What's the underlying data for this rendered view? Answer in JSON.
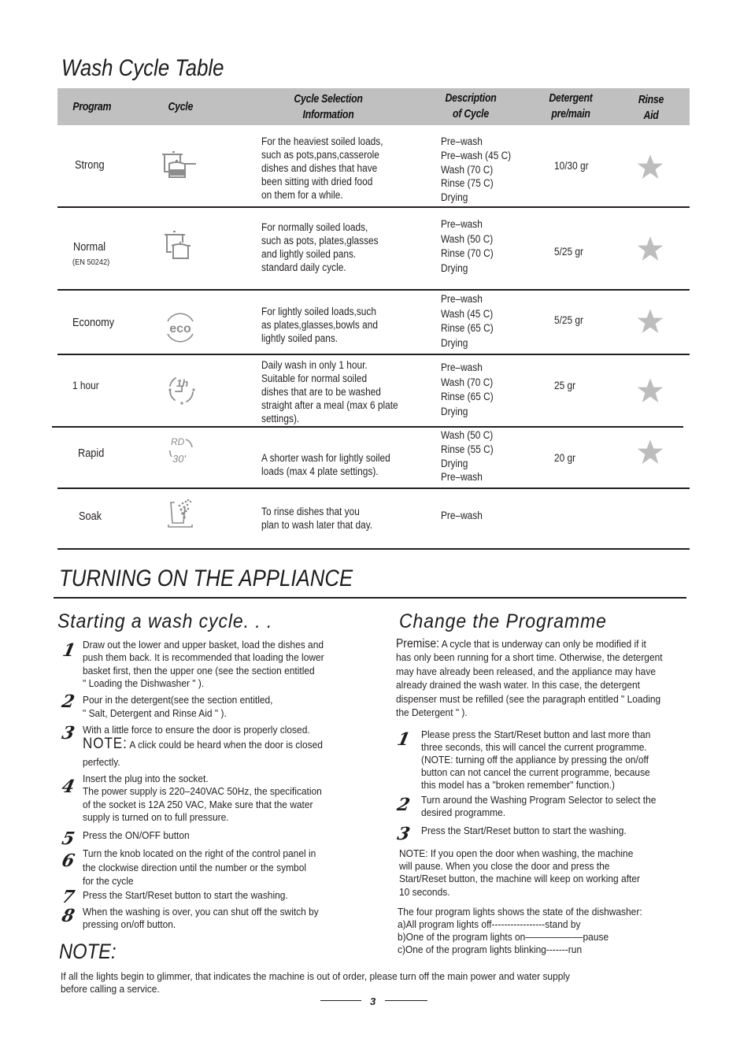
{
  "wash_cycle_table": {
    "title": "Wash Cycle Table",
    "headers": {
      "program": "Program",
      "cycle": "Cycle",
      "cycle_selection_1": "Cycle Selection",
      "cycle_selection_2": "Information",
      "description_1": "Description",
      "description_2": "of Cycle",
      "detergent_1": "Detergent",
      "detergent_2": "pre/main",
      "rinse_1": "Rinse",
      "rinse_2": "Aid"
    },
    "rows": [
      {
        "program": "Strong",
        "program_sub": "",
        "icon": "pots-heavy-icon",
        "info": [
          "For the heaviest soiled loads,",
          "such as pots,pans,casserole",
          "dishes and dishes that have",
          "been sitting with dried food",
          "on them for a while."
        ],
        "description": [
          "Pre–wash",
          "Pre–wash (45  C)",
          "Wash (70  C)",
          "Rinse (75  C)",
          "Drying"
        ],
        "detergent": "10/30 gr",
        "rinse_aid": true
      },
      {
        "program": "Normal",
        "program_sub": "(EN 50242)",
        "icon": "pots-normal-icon",
        "info": [
          "For normally soiled loads,",
          "such as pots, plates,glasses",
          "and lightly soiled pans.",
          "standard daily cycle."
        ],
        "description": [
          "Pre–wash",
          "Wash (50  C)",
          "Rinse (70  C)",
          "Drying"
        ],
        "detergent": "5/25 gr",
        "rinse_aid": true
      },
      {
        "program": "Economy",
        "program_sub": "",
        "icon": "eco-icon",
        "info": [
          "For lightly soiled loads,such",
          "as plates,glasses,bowls and",
          "lightly soiled pans."
        ],
        "description": [
          "Pre–wash",
          "Wash (45  C)",
          "Rinse (65  C)",
          "Drying"
        ],
        "detergent": "5/25 gr",
        "rinse_aid": true
      },
      {
        "program": "1 hour",
        "program_sub": "",
        "icon": "one-hour-icon",
        "info": [
          "Daily wash in only 1 hour.",
          "Suitable for normal soiled",
          "dishes that are to be washed",
          "straight after a meal (max 6 plate",
          "settings)."
        ],
        "description": [
          "Pre–wash",
          "Wash (70  C)",
          "Rinse (65  C)",
          "Drying"
        ],
        "detergent": "25 gr",
        "rinse_aid": true
      },
      {
        "program": "Rapid",
        "program_sub": "",
        "icon": "rapid-30-icon",
        "info": [
          "A shorter wash for lightly soiled",
          "loads (max 4 plate settings)."
        ],
        "description": [
          "Wash (50  C)",
          "Rinse (55  C)",
          "Drying",
          "Pre–wash"
        ],
        "detergent": "20 gr",
        "rinse_aid": true
      },
      {
        "program": "Soak",
        "program_sub": "",
        "icon": "soak-icon",
        "info": [
          "To rinse dishes that you",
          "plan to wash later that day."
        ],
        "description": [
          "Pre–wash"
        ],
        "detergent": "",
        "rinse_aid": false
      }
    ]
  },
  "turning_on": {
    "title": "TURNING ON THE APPLIANCE"
  },
  "starting": {
    "title": "Starting a wash cycle. . .",
    "steps": [
      {
        "n": "1",
        "lines": [
          "Draw out the lower and upper basket, load the dishes and",
          "push them back. It is recommended that loading the lower",
          "basket first, then the upper one (see the section entitled",
          "\" Loading the Dishwasher \" )."
        ]
      },
      {
        "n": "2",
        "lines": [
          "Pour in the detergent(see the section entitled,",
          "\" Salt, Detergent and Rinse Aid \" )."
        ]
      },
      {
        "n": "3",
        "lines": [
          "With a little force to ensure the door is properly closed."
        ],
        "note_label": "NOTE:",
        "note_text": "A click  could be heard when the door is closed",
        "note_cont": "perfectly."
      },
      {
        "n": "4",
        "lines": [
          "Insert the plug into the socket.",
          "The power supply is 220–240VAC 50Hz, the specification",
          "of the socket is 12A 250 VAC, Make sure that the water",
          "supply is turned on to full pressure."
        ]
      },
      {
        "n": "5",
        "lines": [
          "Press the ON/OFF button"
        ]
      },
      {
        "n": "6",
        "lines": [
          "Turn the knob located on the right of the control panel in",
          "the clockwise direction until the number or the symbol",
          "for the cycle"
        ]
      },
      {
        "n": "7",
        "lines": [
          "Press the Start/Reset button to start the washing."
        ]
      },
      {
        "n": "8",
        "lines": [
          "When the washing is over, you can shut off the switch by",
          "pressing on/off button."
        ]
      }
    ]
  },
  "change": {
    "title": "Change the Programme",
    "premise_label": "Premise:",
    "premise_lines": [
      "A cycle that is underway can only be modified if it",
      "has only been running for a short time. Otherwise, the detergent",
      "may have already been released, and the appliance may have",
      "already drained the wash water. In this case, the detergent",
      "dispenser must be refilled (see the paragraph entitled \" Loading",
      "the Detergent \" )."
    ],
    "steps": [
      {
        "n": "1",
        "lines": [
          "Please press the Start/Reset button and last more than",
          "three seconds, this will cancel the current programme.",
          "(NOTE: turning off the appliance by pressing the on/off",
          "button can not cancel the current programme, because",
          "this model has a \"broken remember\" function.)"
        ]
      },
      {
        "n": "2",
        "lines": [
          "Turn around  the Washing Program Selector to select the",
          "desired programme."
        ]
      },
      {
        "n": "3",
        "lines": [
          "Press the Start/Reset  button to start the washing."
        ]
      }
    ],
    "note_lines": [
      "NOTE: If you open the door when washing, the machine",
      "will pause. When you close the door and press the",
      "Start/Reset button, the machine will keep on working after",
      "10 seconds."
    ],
    "lights_lines": [
      "The four program lights shows the state of the dishwasher:",
      "a)All program lights off-----------------stand by",
      "b)One of the program lights on–––––––––––pause",
      "c)One of the program lights blinking-------run"
    ]
  },
  "note": {
    "title": "NOTE:",
    "lines": [
      "If all the lights begin to glimmer, that indicates the machine is out of order, please turn off the main power and water supply",
      "before calling a service."
    ]
  },
  "page_number": "3",
  "colors": {
    "header_bg": "#c0c0c0",
    "icon_gray": "#8c8c8c",
    "star_gray": "#bdbdbd",
    "text": "#231f20"
  }
}
